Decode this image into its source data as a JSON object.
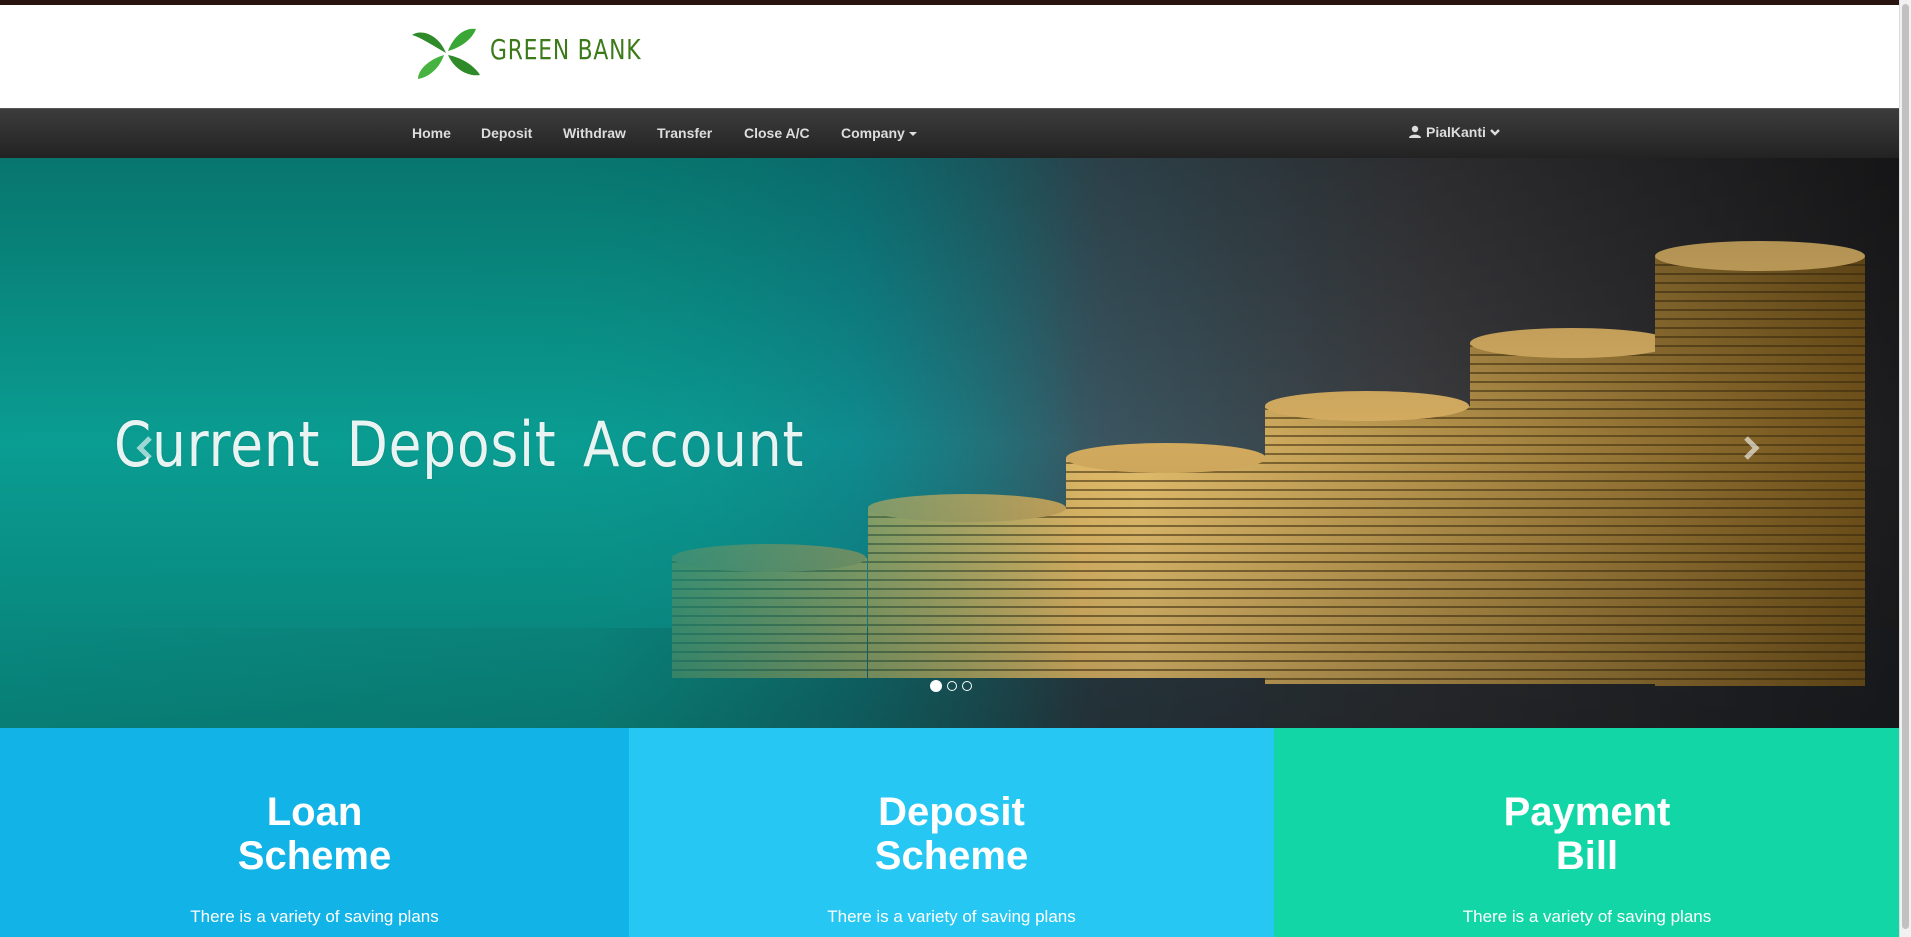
{
  "brand": {
    "name": "GREEN BANK",
    "logo_icon": "four-leaf-icon"
  },
  "nav": {
    "items": [
      {
        "label": "Home"
      },
      {
        "label": "Deposit"
      },
      {
        "label": "Withdraw"
      },
      {
        "label": "Transfer"
      },
      {
        "label": "Close A/C"
      },
      {
        "label": "Company"
      }
    ],
    "user": "PialKanti"
  },
  "carousel": {
    "title": "Current Deposit Account",
    "slide_count": 3,
    "active_slide": 1
  },
  "panels": [
    {
      "title_line1": "Loan",
      "title_line2": "Scheme",
      "text": "There is a variety of saving plans",
      "color": "#12b3e6"
    },
    {
      "title_line1": "Deposit",
      "title_line2": "Scheme",
      "text": "There is a variety of saving plans",
      "color": "#26c7f2"
    },
    {
      "title_line1": "Payment",
      "title_line2": "Bill",
      "text": "There is a variety of saving plans",
      "color": "#13d6a6"
    }
  ],
  "colors": {
    "navbar": "#2b2b2b",
    "teal": "#0a9d92",
    "logo_green": "#3c7a19"
  }
}
